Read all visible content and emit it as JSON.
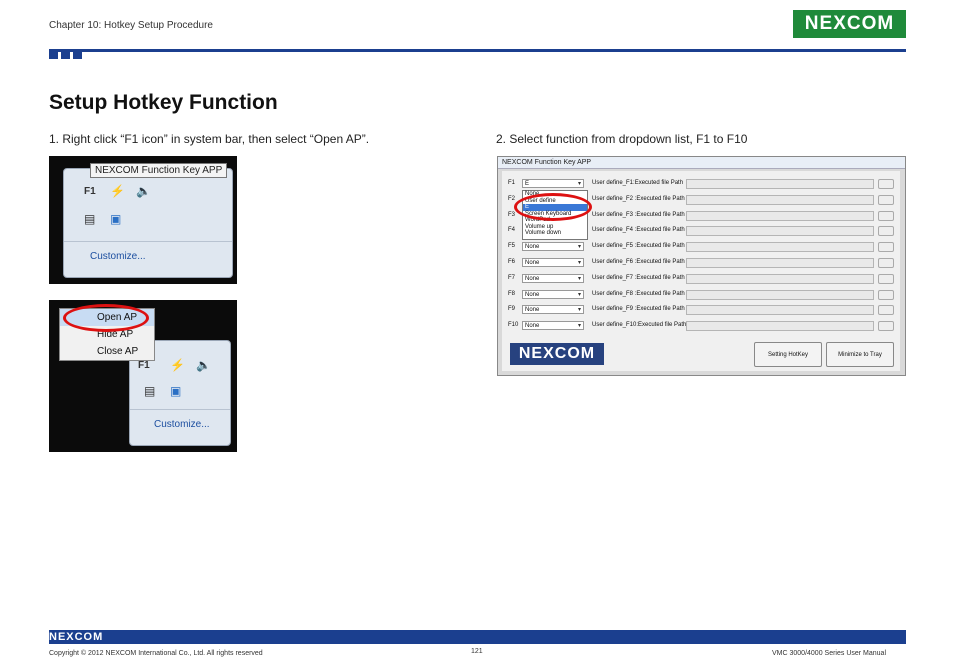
{
  "header": {
    "chapter": "Chapter 10: Hotkey Setup Procedure",
    "logo_text": "NEXCOM",
    "brand_color": "#1b3f8f",
    "logo_color": "#1f8a3a"
  },
  "page_title": "Setup Hotkey Function",
  "steps": {
    "step1": "1. Right click “F1 icon” in system bar, then select “Open AP”.",
    "step2": "2. Select function from dropdown list, F1 to F10"
  },
  "screenshot1": {
    "tooltip": "NEXCOM Function Key APP",
    "f1_label": "F1",
    "customize": "Customize...",
    "icons": [
      "f1-icon",
      "network-muted-icon",
      "speaker-icon",
      "display-icon",
      "monitor-icon"
    ]
  },
  "screenshot2": {
    "menu_items": [
      "Open AP",
      "Hide AP",
      "Close AP"
    ],
    "selected_item": "Open AP",
    "customize": "Customize..."
  },
  "app_window": {
    "title": "NEXCOM Function Key APP",
    "rows": [
      {
        "key": "F1",
        "value": "E",
        "path": "User define_F1:Executed file Path"
      },
      {
        "key": "F2",
        "value": "",
        "path": "User define_F2 :Executed file Path"
      },
      {
        "key": "F3",
        "value": "",
        "path": "User define_F3 :Executed file Path"
      },
      {
        "key": "F4",
        "value": "",
        "path": "User define_F4 :Executed file Path"
      },
      {
        "key": "F5",
        "value": "None",
        "path": "User define_F5 :Executed file Path"
      },
      {
        "key": "F6",
        "value": "None",
        "path": "User define_F6 :Executed file Path"
      },
      {
        "key": "F7",
        "value": "None",
        "path": "User define_F7 :Executed file Path"
      },
      {
        "key": "F8",
        "value": "None",
        "path": "User define_F8 :Executed file Path"
      },
      {
        "key": "F9",
        "value": "None",
        "path": "User define_F9 :Executed file Path"
      },
      {
        "key": "F10",
        "value": "None",
        "path": "User define_F10:Executed file Path"
      }
    ],
    "dropdown_options": [
      "None",
      "User define",
      "E",
      "Screen Keyboard",
      "WordPad",
      "Volume up",
      "Volume down"
    ],
    "highlighted_option": "E",
    "logo_text": "NEXCOM",
    "setting_button": "Setting HotKey",
    "minimize_button": "Minimize to Tray"
  },
  "footer": {
    "logo_text": "NEXCOM",
    "copyright": "Copyright © 2012 NEXCOM International Co., Ltd. All rights reserved",
    "page_number": "121",
    "manual": "VMC 3000/4000 Series User Manual"
  }
}
